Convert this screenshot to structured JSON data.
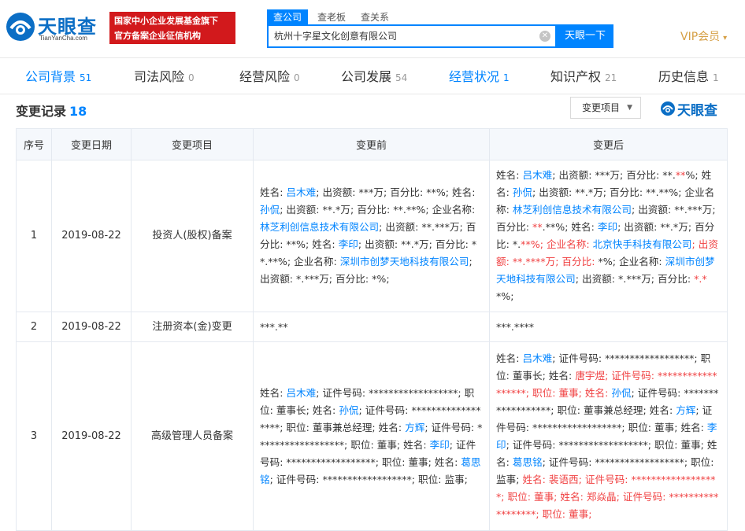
{
  "header": {
    "logo_text": "天眼查",
    "logo_sub": "TianYanCha.com",
    "badge_line1": "国家中小企业发展基金旗下",
    "badge_line2": "官方备案企业征信机构",
    "search_tabs": [
      "查公司",
      "查老板",
      "查关系"
    ],
    "search_value": "杭州十字星文化创意有限公司",
    "search_button": "天眼一下",
    "vip_label": "VIP会员",
    "clear_glyph": "✕",
    "vip_caret": "▾"
  },
  "nav": [
    {
      "label": "公司背景",
      "count": "51"
    },
    {
      "label": "司法风险",
      "count": "0"
    },
    {
      "label": "经营风险",
      "count": "0"
    },
    {
      "label": "公司发展",
      "count": "54"
    },
    {
      "label": "经营状况",
      "count": "1"
    },
    {
      "label": "知识产权",
      "count": "21"
    },
    {
      "label": "历史信息",
      "count": "1"
    }
  ],
  "section": {
    "title": "变更记录",
    "count": "18",
    "filter_label": "变更项目",
    "filter_caret": "▼",
    "watermark": "天眼查"
  },
  "table": {
    "headers": [
      "序号",
      "变更日期",
      "变更项目",
      "变更前",
      "变更后"
    ],
    "rows": [
      {
        "index": "1",
        "date": "2019-08-22",
        "item": "投资人(股权)备案",
        "before": [
          {
            "t": "姓名: "
          },
          {
            "t": "吕木难",
            "c": "lnk"
          },
          {
            "t": "; 出资额: ***万; 百分比: **%; 姓名: "
          },
          {
            "t": "孙侃",
            "c": "lnk"
          },
          {
            "t": "; 出资额: **.*万; 百分比: **.**%; 企业名称: "
          },
          {
            "t": "林芝利创信息技术有限公司",
            "c": "lnk"
          },
          {
            "t": "; 出资额: **.***万; 百分比: **%; 姓名: "
          },
          {
            "t": "李印",
            "c": "lnk"
          },
          {
            "t": "; 出资额: **.*万; 百分比: **.**%; 企业名称: "
          },
          {
            "t": "深圳市创梦天地科技有限公司",
            "c": "lnk"
          },
          {
            "t": "; 出资额: *.***万; 百分比: *%;"
          }
        ],
        "after": [
          {
            "t": "姓名: "
          },
          {
            "t": "吕木难",
            "c": "lnk"
          },
          {
            "t": "; 出资额: ***万; 百分比: **."
          },
          {
            "t": "**",
            "c": "red"
          },
          {
            "t": "%; 姓名: "
          },
          {
            "t": "孙侃",
            "c": "lnk"
          },
          {
            "t": "; 出资额: **.*万; 百分比: **.**%; 企业名称: "
          },
          {
            "t": "林芝利创信息技术有限公司",
            "c": "lnk"
          },
          {
            "t": "; 出资额: **.***万; 百分比: "
          },
          {
            "t": "**",
            "c": "red"
          },
          {
            "t": ".**%; 姓名: "
          },
          {
            "t": "李印",
            "c": "lnk"
          },
          {
            "t": "; 出资额: **.*万; 百分比: *."
          },
          {
            "t": "**%; 企业名称: ",
            "c": "red"
          },
          {
            "t": "北京快手科技有限公司",
            "c": "lnk"
          },
          {
            "t": "; 出资额: **.****万; 百分比: ",
            "c": "red"
          },
          {
            "t": "*%; 企业名称: "
          },
          {
            "t": "深圳市创梦天地科技有限公司",
            "c": "lnk"
          },
          {
            "t": "; 出资额: *.***万; 百分比: "
          },
          {
            "t": "*.*",
            "c": "red"
          },
          {
            "t": "*%;"
          }
        ]
      },
      {
        "index": "2",
        "date": "2019-08-22",
        "item": "注册资本(金)变更",
        "before": [
          {
            "t": "***.**"
          }
        ],
        "after": [
          {
            "t": "***.****"
          }
        ]
      },
      {
        "index": "3",
        "date": "2019-08-22",
        "item": "高级管理人员备案",
        "before": [
          {
            "t": "姓名: "
          },
          {
            "t": "吕木难",
            "c": "lnk"
          },
          {
            "t": "; 证件号码: ******************; 职位: 董事长; 姓名: "
          },
          {
            "t": "孙侃",
            "c": "lnk"
          },
          {
            "t": "; 证件号码: ******************; 职位: 董事兼总经理; 姓名: "
          },
          {
            "t": "方辉",
            "c": "lnk"
          },
          {
            "t": "; 证件号码: ******************; 职位: 董事; 姓名: "
          },
          {
            "t": "李印",
            "c": "lnk"
          },
          {
            "t": "; 证件号码: ******************; 职位: 董事; 姓名: "
          },
          {
            "t": "葛思铭",
            "c": "lnk"
          },
          {
            "t": "; 证件号码: ******************; 职位: 监事;"
          }
        ],
        "after": [
          {
            "t": "姓名: "
          },
          {
            "t": "吕木难",
            "c": "lnk"
          },
          {
            "t": "; 证件号码: ******************; 职位: 董事长; 姓名: "
          },
          {
            "t": "唐宇煜; 证件号码: ******************; 职位: 董事; 姓名: ",
            "c": "red"
          },
          {
            "t": "孙侃",
            "c": "lnk"
          },
          {
            "t": "; 证件号码: ******************; 职位: 董事兼总经理; 姓名: "
          },
          {
            "t": "方辉",
            "c": "lnk"
          },
          {
            "t": "; 证件号码: ******************; 职位: 董事; 姓名: "
          },
          {
            "t": "李印",
            "c": "lnk"
          },
          {
            "t": "; 证件号码: ******************; 职位: 董事; 姓名: "
          },
          {
            "t": "葛思铭",
            "c": "lnk"
          },
          {
            "t": "; 证件号码: ******************; 职位: 监事; "
          },
          {
            "t": "姓名: 裴语西; 证件号码: ******************; 职位: 董事; 姓名: 郑焱晶; 证件号码: ******************; 职位: 董事;",
            "c": "red"
          }
        ]
      }
    ]
  },
  "colors": {
    "brand_blue": "#0084ff",
    "logo_blue": "#0b6ec5",
    "badge_red": "#d2191c",
    "change_red": "#f04142",
    "vip_gold": "#d6a046"
  }
}
